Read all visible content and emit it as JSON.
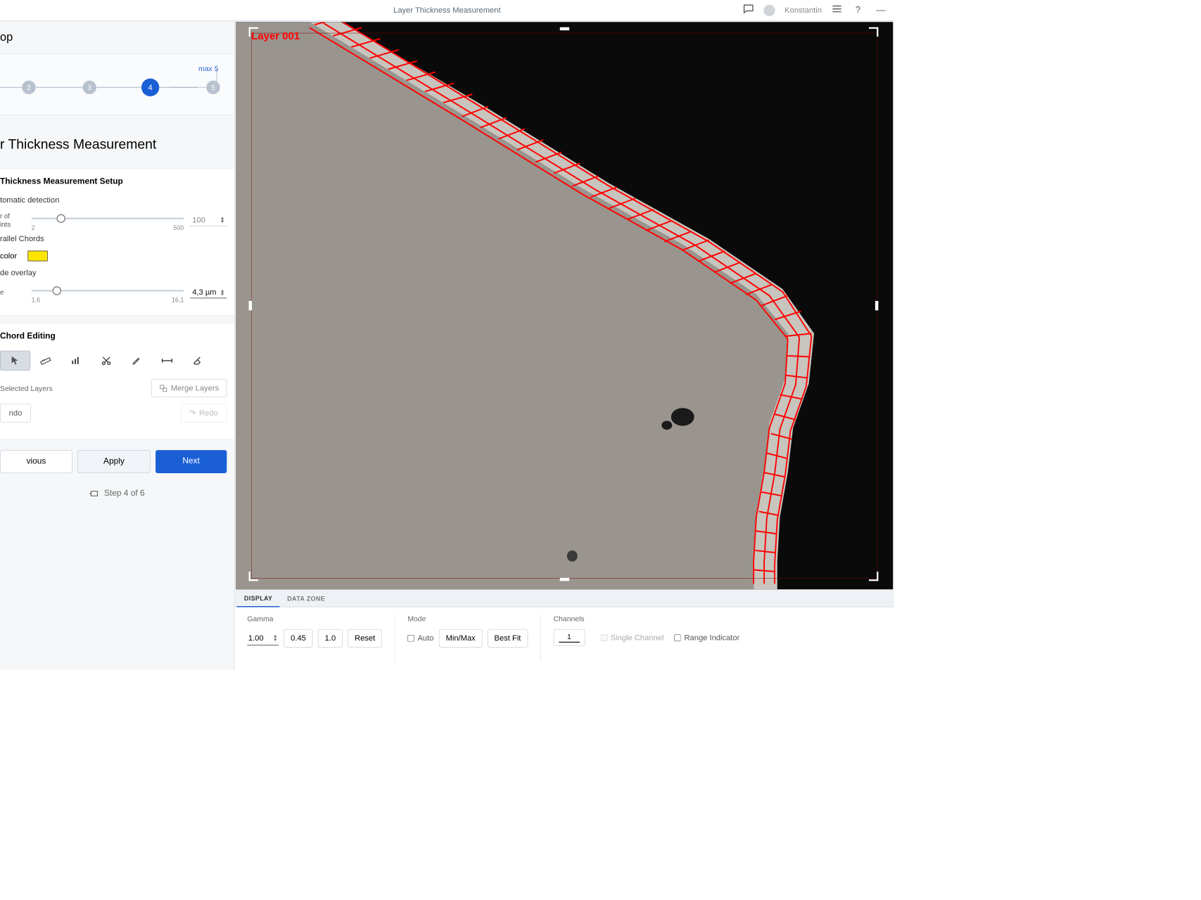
{
  "titlebar": {
    "title": "Layer Thickness Measurement",
    "user": "Konstantin"
  },
  "sidebar": {
    "loop_label": "op",
    "stepper": {
      "max_label": "max 5",
      "nodes": [
        "2",
        "3",
        "4",
        "5"
      ],
      "active": "4"
    },
    "section_title": "r Thickness Measurement",
    "setup": {
      "header": "Thickness Measurement Setup",
      "auto_detect": "tomatic detection",
      "number_points_label": "r of\nints",
      "np_min": "2",
      "np_max": "500",
      "np_value": "100",
      "parallel_chords": "rallel Chords",
      "color_label": " color",
      "hide_overlay": "de overlay",
      "e_label": "e",
      "e_min": "1,6",
      "e_max": "16,1",
      "e_value": "4,3 µm"
    },
    "editing": {
      "header": "Chord Editing",
      "selected_layers": "Selected Layers",
      "merge": "Merge Layers",
      "undo": "ndo",
      "redo": "Redo"
    },
    "nav": {
      "prev": "vious",
      "apply": "Apply",
      "next": "Next"
    },
    "step_indicator": "Step 4 of 6"
  },
  "viewer": {
    "layer_label": "Layer 001"
  },
  "bottom": {
    "tabs": {
      "display": "DISPLAY",
      "datazone": "DATA ZONE"
    },
    "gamma": {
      "label": "Gamma",
      "value": "1.00",
      "p045": "0.45",
      "p10": "1.0",
      "reset": "Reset"
    },
    "mode": {
      "label": "Mode",
      "auto": "Auto",
      "minmax": "Min/Max",
      "bestfit": "Best Fit"
    },
    "channels": {
      "label": "Channels",
      "value": "1",
      "single": "Single Channel",
      "range": "Range Indicator"
    }
  }
}
